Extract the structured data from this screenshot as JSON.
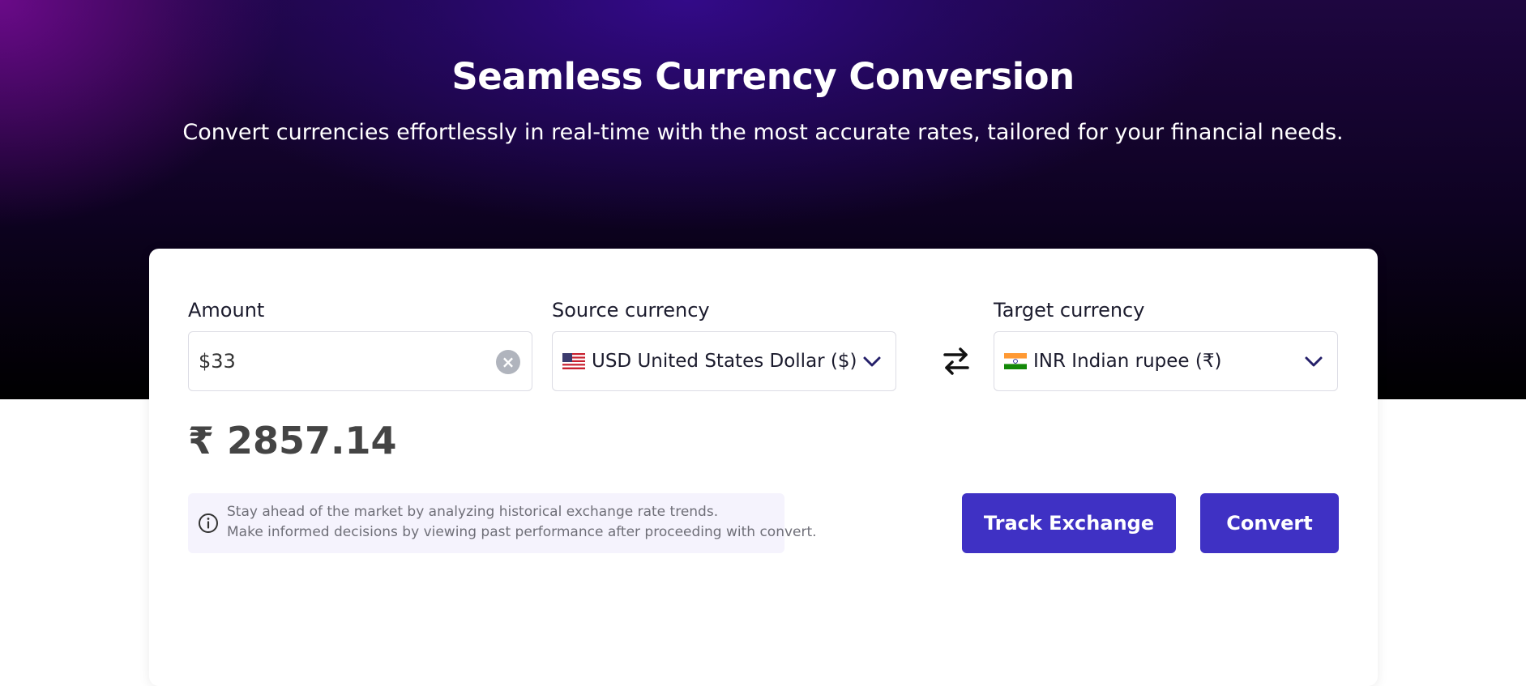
{
  "hero": {
    "title": "Seamless Currency Conversion",
    "subtitle": "Convert currencies effortlessly in real-time with the most accurate rates, tailored for your financial needs."
  },
  "converter": {
    "amount": {
      "label": "Amount",
      "value": "$33"
    },
    "source": {
      "label": "Source currency",
      "selected": "USD United States Dollar ($)",
      "flag": "us-flag-icon"
    },
    "target": {
      "label": "Target currency",
      "selected": "INR Indian rupee (₹)",
      "flag": "india-flag-icon"
    },
    "result": "₹ 2857.14",
    "info": {
      "line1": "Stay ahead of the market by analyzing historical exchange rate trends.",
      "line2": "Make informed decisions by viewing past performance after proceeding with convert."
    },
    "buttons": {
      "track": "Track Exchange",
      "convert": "Convert"
    }
  },
  "colors": {
    "primary_button": "#3f31c4",
    "hero_top": "#2d0a7a",
    "hero_bottom": "#000000",
    "info_bg": "#f5f3fd"
  },
  "icons": {
    "clear": "clear-icon",
    "chevron": "chevron-down-icon",
    "swap": "swap-icon",
    "info": "info-icon"
  }
}
